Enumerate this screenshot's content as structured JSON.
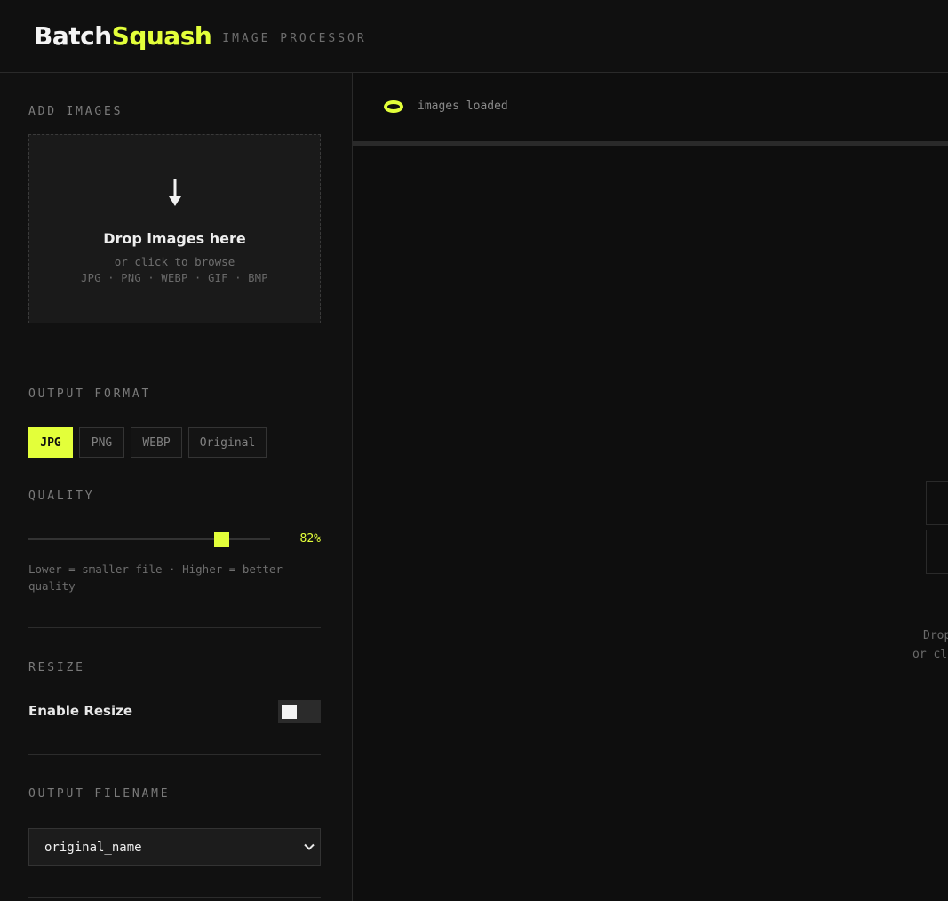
{
  "header": {
    "logo_part1": "Batch",
    "logo_part2": "Squash",
    "subtitle": "IMAGE PROCESSOR"
  },
  "sidebar": {
    "add_images": {
      "label": "ADD IMAGES",
      "dropzone_title": "Drop images here",
      "dropzone_sub": "or click to browse",
      "dropzone_formats": "JPG · PNG · WEBP · GIF · BMP"
    },
    "output_format": {
      "label": "OUTPUT FORMAT",
      "options": [
        "JPG",
        "PNG",
        "WEBP",
        "Original"
      ],
      "selected": "JPG"
    },
    "quality": {
      "label": "QUALITY",
      "value": 82,
      "value_text": "82%",
      "hint": "Lower = smaller file · Higher = better quality"
    },
    "resize": {
      "label": "RESIZE",
      "toggle_label": "Enable Resize",
      "enabled": false
    },
    "output_filename": {
      "label": "OUTPUT FILENAME",
      "selected": "original_name"
    }
  },
  "main": {
    "status_text": "images loaded",
    "placeholder_line1": "Drop",
    "placeholder_line2": "or cl"
  },
  "colors": {
    "accent": "#e3ff3a",
    "background": "#0f0f0f",
    "panel": "#1a1a1a"
  }
}
